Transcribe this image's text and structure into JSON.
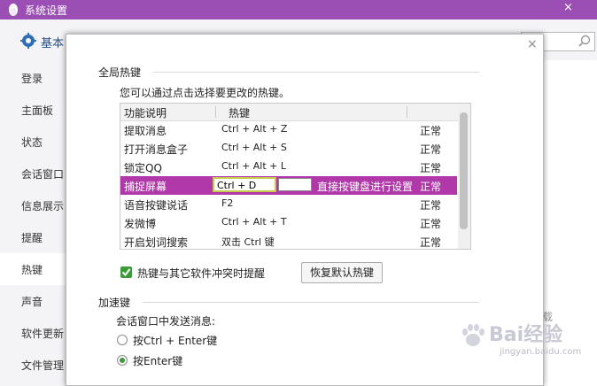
{
  "window": {
    "title": "系统设置",
    "close_glyph": "×"
  },
  "toolbar": {
    "tab_basic": "基本"
  },
  "sidebar": {
    "items": [
      {
        "label": "登录"
      },
      {
        "label": "主面板"
      },
      {
        "label": "状态"
      },
      {
        "label": "会话窗口"
      },
      {
        "label": "信息展示"
      },
      {
        "label": "提醒"
      },
      {
        "label": "热键",
        "active": true
      },
      {
        "label": "声音"
      },
      {
        "label": "软件更新"
      },
      {
        "label": "文件管理"
      }
    ]
  },
  "right_panel": {
    "clipped_text": "载"
  },
  "dialog": {
    "close_glyph": "×",
    "hotkeys_section": {
      "title": "全局热键",
      "description": "您可以通过点击选择要更改的热键。",
      "columns": [
        "功能说明",
        "热键"
      ],
      "rows": [
        {
          "function": "提取消息",
          "hotkey": "Ctrl + Alt + Z",
          "status": "正常"
        },
        {
          "function": "打开消息盒子",
          "hotkey": "Ctrl + Alt + S",
          "status": "正常"
        },
        {
          "function": "锁定QQ",
          "hotkey": "Ctrl + Alt + L",
          "status": "正常"
        },
        {
          "function": "捕捉屏幕",
          "hotkey": "Ctrl + D",
          "hint": "直接按键盘进行设置",
          "status": "正常",
          "selected": true
        },
        {
          "function": "语音按键说话",
          "hotkey": "F2",
          "status": "正常"
        },
        {
          "function": "发微博",
          "hotkey": "Ctrl + Alt + T",
          "status": "正常"
        },
        {
          "function": "开启划词搜索",
          "hotkey": "双击 Ctrl 键",
          "status": "正常"
        }
      ],
      "conflict_checkbox": {
        "label": "热键与其它软件冲突时提醒",
        "checked": true
      },
      "restore_button": "恢复默认热键"
    },
    "accel_section": {
      "title": "加速键",
      "description": "会话窗口中发送消息:",
      "options": [
        {
          "label": "按Ctrl + Enter键",
          "selected": false
        },
        {
          "label": "按Enter键",
          "selected": true
        }
      ]
    }
  },
  "watermark": {
    "text": "Bai经验",
    "url": "jingyan.baidu.com"
  },
  "colors": {
    "titlebar": "#9b4fb4",
    "selected_row": "#b038a9",
    "check_green": "#3d9a3a",
    "edit_border": "#c5c84a"
  }
}
